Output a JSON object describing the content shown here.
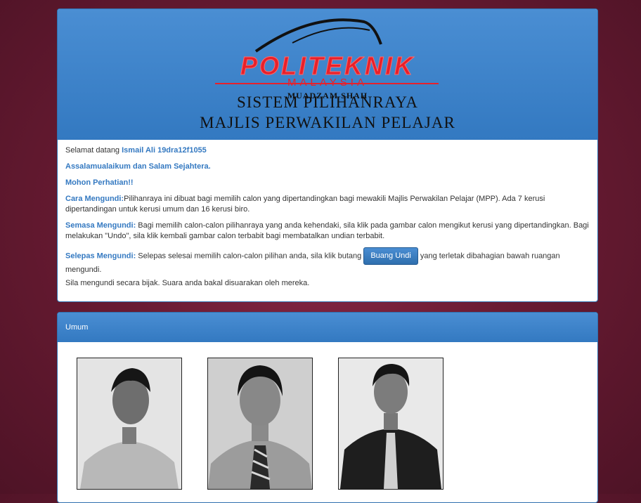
{
  "header": {
    "logo_text": "POLITEKNIK",
    "logo_sub": "MALAYSIA",
    "logo_campus": "MUADZAM SHAH",
    "title_line1": "SISTEM PILIHANRAYA",
    "title_line2": "MAJLIS PERWAKILAN PELAJAR"
  },
  "welcome": {
    "prefix": "Selamat datang",
    "user": "Ismail Ali 19dra12f1055"
  },
  "greeting": "Assalamualaikum dan Salam Sejahtera.",
  "notice": "Mohon Perhatian!!",
  "instructions": {
    "cara_label": "Cara Mengundi:",
    "cara_text": "Pilihanraya ini dibuat bagi memilih calon yang dipertandingkan bagi mewakili Majlis Perwakilan Pelajar (MPP). Ada 7 kerusi dipertandingan untuk kerusi umum dan 16 kerusi biro.",
    "semasa_label": "Semasa Mengundi:",
    "semasa_text": " Bagi memilih calon-calon pilihanraya yang anda kehendaki, sila klik pada gambar calon mengikut kerusi yang dipertandingkan. Bagi melakukan \"Undo\", sila klik kembali gambar calon terbabit bagi membatalkan undian terbabit.",
    "selepas_label": "Selepas Mengundi:",
    "selepas_text_before": " Selepas selesai memilih calon-calon pilihan anda, sila klik butang",
    "vote_button": "Buang Undi",
    "selepas_text_after": "yang terletak dibahagian bawah ruangan mengundi.",
    "closing": "Sila mengundi secara bijak. Suara anda bakal disuarakan oleh mereka."
  },
  "section": {
    "title": "Umum",
    "candidates": [
      {
        "shirt": "#b8b8b8",
        "tie": false
      },
      {
        "shirt": "#9c9c9c",
        "tie": true
      },
      {
        "shirt": "#1e1e1e",
        "tie": true
      }
    ]
  },
  "colors": {
    "accent": "#3479c1",
    "brand_red": "#e8202a",
    "background": "#6a1b33"
  }
}
